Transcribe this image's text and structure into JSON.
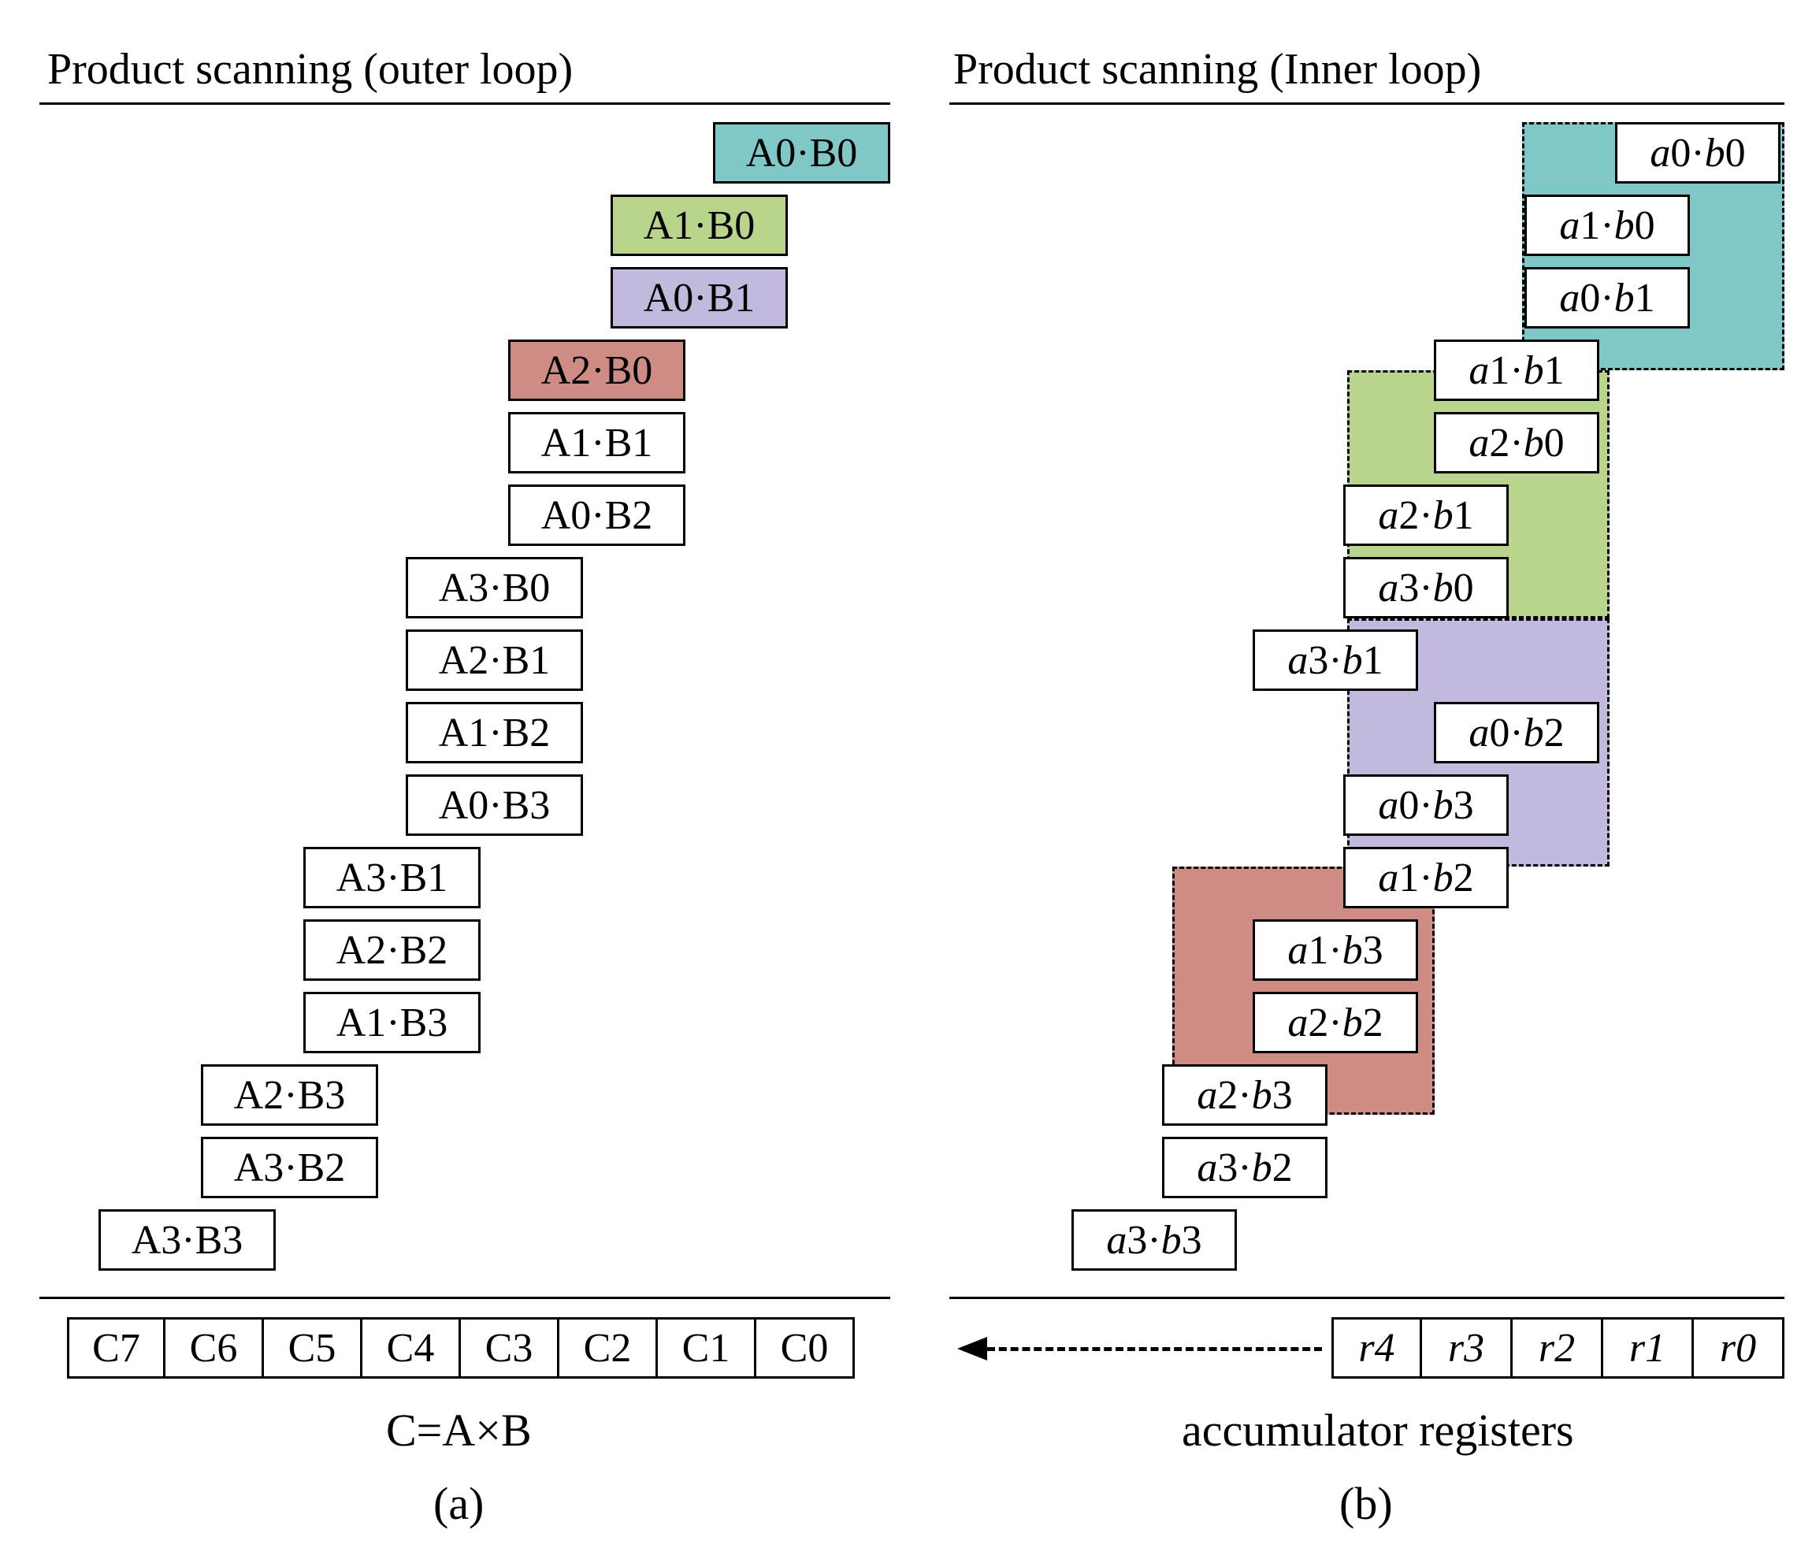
{
  "left": {
    "title": "Product scanning (outer loop)",
    "rows": [
      {
        "label": "A0·B0",
        "col": 0,
        "color": "teal"
      },
      {
        "label": "A1·B0",
        "col": 1,
        "color": "green"
      },
      {
        "label": "A0·B1",
        "col": 1,
        "color": "purple"
      },
      {
        "label": "A2·B0",
        "col": 2,
        "color": "red"
      },
      {
        "label": "A1·B1",
        "col": 2,
        "color": ""
      },
      {
        "label": "A0·B2",
        "col": 2,
        "color": ""
      },
      {
        "label": "A3·B0",
        "col": 3,
        "color": ""
      },
      {
        "label": "A2·B1",
        "col": 3,
        "color": ""
      },
      {
        "label": "A1·B2",
        "col": 3,
        "color": ""
      },
      {
        "label": "A0·B3",
        "col": 3,
        "color": ""
      },
      {
        "label": "A3·B1",
        "col": 4,
        "color": ""
      },
      {
        "label": "A2·B2",
        "col": 4,
        "color": ""
      },
      {
        "label": "A1·B3",
        "col": 4,
        "color": ""
      },
      {
        "label": "A2·B3",
        "col": 5,
        "color": ""
      },
      {
        "label": "A3·B2",
        "col": 5,
        "color": ""
      },
      {
        "label": "A3·B3",
        "col": 6,
        "color": ""
      }
    ],
    "result": [
      "C7",
      "C6",
      "C5",
      "C4",
      "C3",
      "C2",
      "C1",
      "C0"
    ],
    "caption": "C=A×B",
    "sub": "(a)"
  },
  "right": {
    "title": "Product scanning (Inner loop)",
    "rows": [
      {
        "label": "a0·b0",
        "col": 0
      },
      {
        "label": "a1·b0",
        "col": 1
      },
      {
        "label": "a0·b1",
        "col": 1
      },
      {
        "label": "a1·b1",
        "col": 2
      },
      {
        "label": "a2·b0",
        "col": 2
      },
      {
        "label": "a2·b1",
        "col": 3
      },
      {
        "label": "a3·b0",
        "col": 3
      },
      {
        "label": "a3·b1",
        "col": 4
      },
      {
        "label": "a0·b2",
        "col": 2
      },
      {
        "label": "a0·b3",
        "col": 3
      },
      {
        "label": "a1·b2",
        "col": 3
      },
      {
        "label": "a1·b3",
        "col": 4
      },
      {
        "label": "a2·b2",
        "col": 4
      },
      {
        "label": "a2·b3",
        "col": 5
      },
      {
        "label": "a3·b2",
        "col": 5
      },
      {
        "label": "a3·b3",
        "col": 6
      }
    ],
    "result": [
      "r4",
      "r3",
      "r2",
      "r1",
      "r0"
    ],
    "caption": "accumulator registers",
    "sub": "(b)"
  }
}
